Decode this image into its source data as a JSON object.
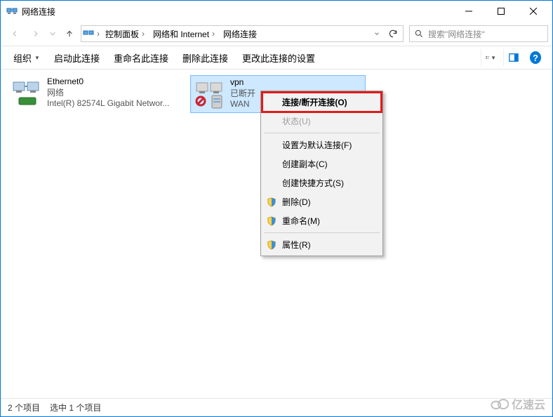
{
  "window": {
    "title": "网络连接"
  },
  "breadcrumb": {
    "items": [
      "控制面板",
      "网络和 Internet",
      "网络连接"
    ]
  },
  "search": {
    "placeholder": "搜索\"网络连接\""
  },
  "commands": {
    "organize": "组织",
    "start": "启动此连接",
    "rename": "重命名此连接",
    "delete": "删除此连接",
    "change": "更改此连接的设置"
  },
  "connections": [
    {
      "name": "Ethernet0",
      "line2": "网络",
      "line3": "Intel(R) 82574L Gigabit Networ...",
      "selected": false
    },
    {
      "name": "vpn",
      "line2": "已断开",
      "line3": "WAN",
      "selected": true
    }
  ],
  "context_menu": {
    "items": [
      {
        "label": "连接/断开连接(O)",
        "bold": true,
        "highlight": true,
        "enabled": true
      },
      {
        "label": "状态(U)",
        "enabled": false
      },
      {
        "sep": true
      },
      {
        "label": "设置为默认连接(F)",
        "enabled": true
      },
      {
        "label": "创建副本(C)",
        "enabled": true
      },
      {
        "label": "创建快捷方式(S)",
        "enabled": true
      },
      {
        "label": "删除(D)",
        "enabled": true,
        "shield": true
      },
      {
        "label": "重命名(M)",
        "enabled": true,
        "shield": true
      },
      {
        "sep": true
      },
      {
        "label": "属性(R)",
        "enabled": true,
        "shield": true
      }
    ]
  },
  "status": {
    "count": "2 个项目",
    "selected": "选中 1 个项目"
  },
  "watermark": "亿速云"
}
